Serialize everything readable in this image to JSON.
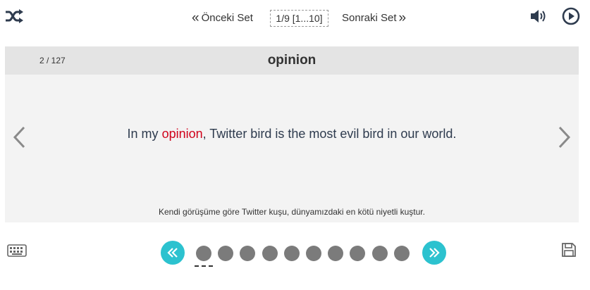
{
  "toolbar": {
    "shuffle_icon": "shuffle-icon",
    "speaker_icon": "speaker-icon",
    "play_icon": "play-circle-icon"
  },
  "set_nav": {
    "prev_label": "Önceki Set",
    "current": "1/9 [1...10]",
    "next_label": "Sonraki Set"
  },
  "card": {
    "counter": "2 / 127",
    "word": "opinion",
    "sentence_before": "In my ",
    "sentence_highlight": "opinion",
    "sentence_after": ", Twitter bird is the most evil bird in our world.",
    "translation": "Kendi görüşüme göre Twitter kuşu, dünyamızdaki en kötü niyetli kuştur.",
    "highlight_color": "#d0021b"
  },
  "pager": {
    "dot_count": 10,
    "active_index": 0,
    "accent_color": "#2cc2cf"
  }
}
